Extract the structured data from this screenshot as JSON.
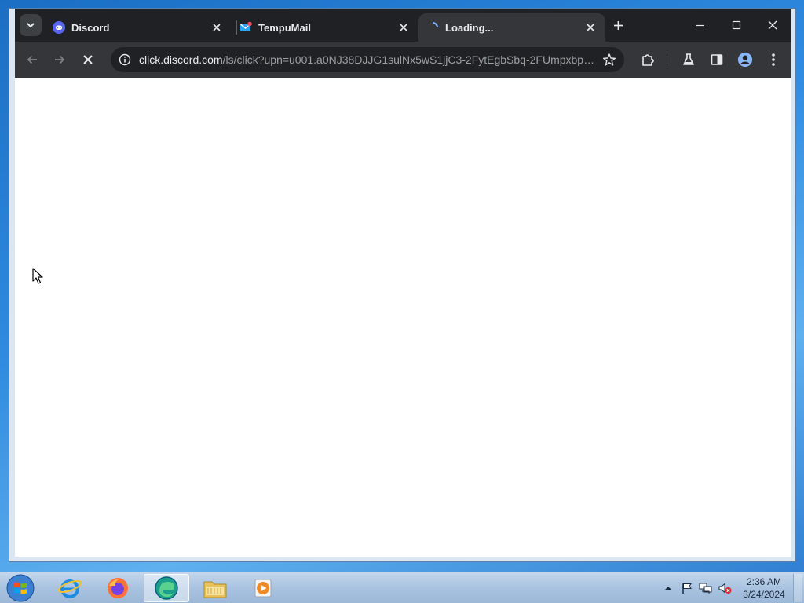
{
  "browser": {
    "tabs": [
      {
        "title": "Discord",
        "active": false
      },
      {
        "title": "TempuMail",
        "active": false
      },
      {
        "title": "Loading...",
        "active": true
      }
    ],
    "address_bar": {
      "host": "click.discord.com",
      "path": "/ls/click?upn=u001.a0NJ38DJJG1sulNx5wS1jjC3-2FytEgbSbq-2FUmpxbpkb..."
    }
  },
  "taskbar": {
    "clock_time": "2:36 AM",
    "clock_date": "3/24/2024"
  },
  "colors": {
    "chrome_dark": "#202124",
    "chrome_toolbar": "#35363a",
    "discord_blurple": "#5865f2",
    "tab_text": "#e8eaed"
  }
}
